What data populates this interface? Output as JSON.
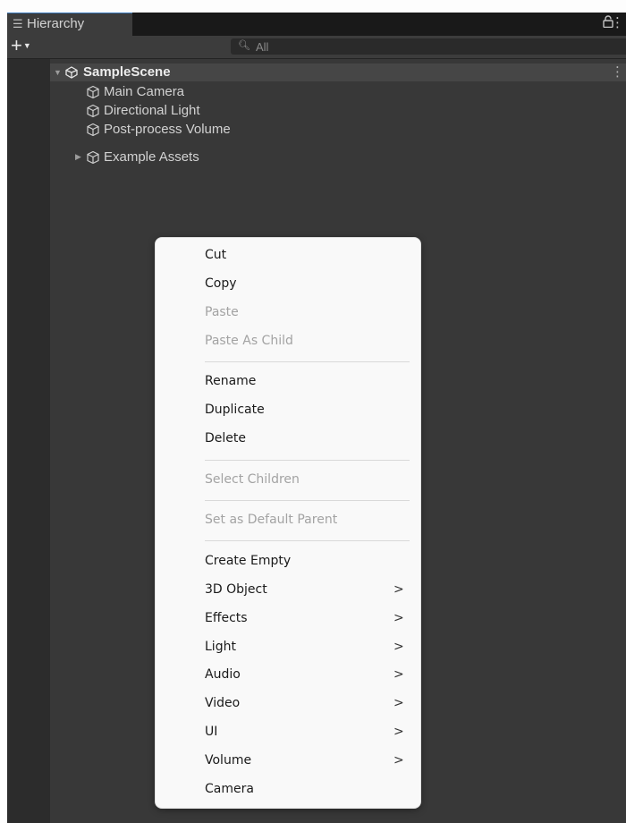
{
  "window": {
    "tab_label": "Hierarchy",
    "tab_icon": "hierarchy-list-icon",
    "lock_icon": "lock-icon",
    "menu_icon": "kebab-menu-icon"
  },
  "toolbar": {
    "add_label": "+",
    "add_icon": "plus-dropdown-icon",
    "search_placeholder": "All",
    "search_icon": "search-filter-icon"
  },
  "hierarchy": {
    "scene": {
      "name": "SampleScene",
      "icon": "unity-logo-icon",
      "expanded": true
    },
    "items": [
      {
        "label": "Main Camera",
        "icon": "gameobject-cube-icon",
        "has_children": false
      },
      {
        "label": "Directional Light",
        "icon": "gameobject-cube-icon",
        "has_children": false
      },
      {
        "label": "Post-process Volume",
        "icon": "gameobject-cube-icon",
        "has_children": false
      },
      {
        "label": "Example Assets",
        "icon": "gameobject-cube-icon",
        "has_children": true
      }
    ]
  },
  "context_menu": {
    "items": [
      {
        "label": "Cut",
        "enabled": true
      },
      {
        "label": "Copy",
        "enabled": true
      },
      {
        "label": "Paste",
        "enabled": false
      },
      {
        "label": "Paste As Child",
        "enabled": false
      },
      {
        "label": "Rename",
        "enabled": true
      },
      {
        "label": "Duplicate",
        "enabled": true
      },
      {
        "label": "Delete",
        "enabled": true
      },
      {
        "label": "Select Children",
        "enabled": false
      },
      {
        "label": "Set as Default Parent",
        "enabled": false
      },
      {
        "label": "Create Empty",
        "enabled": true
      },
      {
        "label": "3D Object",
        "enabled": true,
        "submenu": true
      },
      {
        "label": "Effects",
        "enabled": true,
        "submenu": true
      },
      {
        "label": "Light",
        "enabled": true,
        "submenu": true
      },
      {
        "label": "Audio",
        "enabled": true,
        "submenu": true
      },
      {
        "label": "Video",
        "enabled": true,
        "submenu": true
      },
      {
        "label": "UI",
        "enabled": true,
        "submenu": true
      },
      {
        "label": "Volume",
        "enabled": true,
        "submenu": true
      },
      {
        "label": "Camera",
        "enabled": true
      }
    ],
    "submenu_glyph": ">"
  },
  "colors": {
    "panel_bg": "#383838",
    "tab_bar_bg": "#191919",
    "menu_bg": "#f9f9f9",
    "disabled_text": "#a3a3a3"
  }
}
